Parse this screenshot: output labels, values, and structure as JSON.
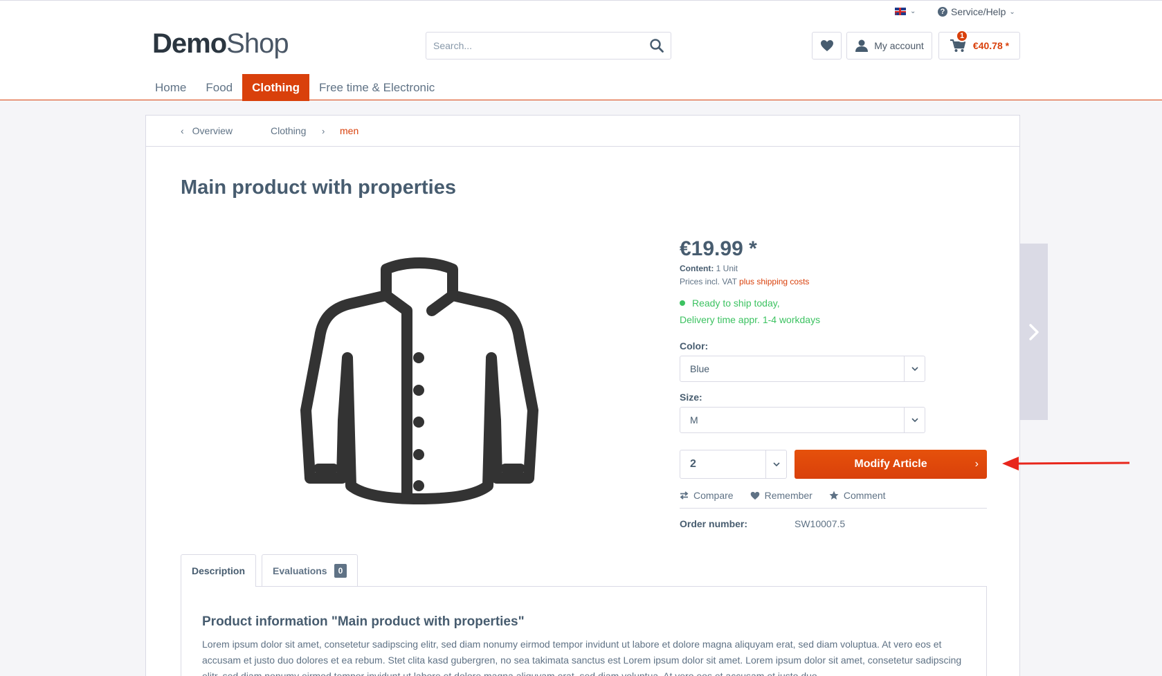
{
  "header": {
    "service_help": "Service/Help",
    "logo_demo": "Demo",
    "logo_shop": "Shop",
    "search_placeholder": "Search...",
    "account_label": "My account",
    "cart_total": "€40.78 *",
    "cart_count": "1"
  },
  "nav": {
    "items": [
      {
        "label": "Home"
      },
      {
        "label": "Food"
      },
      {
        "label": "Clothing",
        "active": true
      },
      {
        "label": "Free time & Electronic"
      }
    ]
  },
  "breadcrumb": {
    "back": "Overview",
    "items": [
      "Clothing",
      "men"
    ]
  },
  "product": {
    "title": "Main product with properties",
    "price": "€19.99 *",
    "content_label": "Content:",
    "content_value": "1 Unit",
    "vat_text": "Prices incl. VAT",
    "shipping_link": "plus shipping costs",
    "delivery_line1": "Ready to ship today,",
    "delivery_line2": "Delivery time appr. 1-4 workdays",
    "color_label": "Color:",
    "color_value": "Blue",
    "size_label": "Size:",
    "size_value": "M",
    "quantity": "2",
    "buy_button": "Modify Article",
    "actions": {
      "compare": "Compare",
      "remember": "Remember",
      "comment": "Comment"
    },
    "order_number_label": "Order number:",
    "order_number_value": "SW10007.5"
  },
  "tabs": {
    "description": "Description",
    "evaluations": "Evaluations",
    "evaluations_count": "0"
  },
  "description": {
    "heading": "Product information \"Main product with properties\"",
    "text": "Lorem ipsum dolor sit amet, consetetur sadipscing elitr, sed diam nonumy eirmod tempor invidunt ut labore et dolore magna aliquyam erat, sed diam voluptua. At vero eos et accusam et justo duo dolores et ea rebum. Stet clita kasd gubergren, no sea takimata sanctus est Lorem ipsum dolor sit amet. Lorem ipsum dolor sit amet, consetetur sadipscing elitr, sed diam nonumy eirmod tempor invidunt ut labore et dolore magna aliquyam erat, sed diam voluptua. At vero eos et accusam et justo duo"
  },
  "colors": {
    "accent": "#d9400b",
    "success": "#3cc261",
    "text": "#5f7285",
    "heading": "#475c6f",
    "border": "#dadae5"
  },
  "icons": [
    "flag-uk-icon",
    "help-icon",
    "search-icon",
    "heart-icon",
    "user-icon",
    "cart-icon",
    "chevron-left-icon",
    "chevron-right-icon",
    "chevron-down-icon",
    "compare-icon",
    "star-icon",
    "jacket-image",
    "arrow-annotation"
  ]
}
